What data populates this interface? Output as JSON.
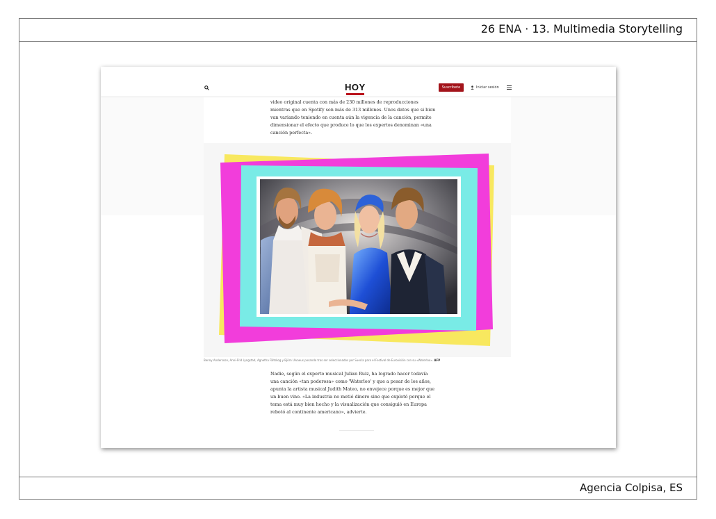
{
  "slide": {
    "title": "26 ENA · 13. Multimedia Storytelling",
    "credit": "Agencia Colpisa, ES"
  },
  "site": {
    "logo": "HOY",
    "subscribe_label": "Suscríbete",
    "login_label": "Iniciar sesión",
    "icons": [
      "search-icon",
      "user-icon",
      "menu-icon"
    ]
  },
  "article": {
    "top_lines": [
      "video original cuenta con más de 230 millones de reproducciones",
      "mientras que en Spotify son más de 313 millones. Unos datos que si bien",
      "van variando teniendo en cuenta aún la vigencia de la canción, permite",
      "dimensionar el efecto que produce lo que los expertos denominan «una",
      "canción perfecta»."
    ],
    "caption": "Benny Andersson, Anni-Frid Lyngstad, Agnetha Fältskog y Björn Ulvaeus posando tras ser seleccionados por Suecia para el Festival de Eurovisión con su «Waterloo».",
    "caption_source": "AFP",
    "bottom_lines": [
      "Nadie, según el experto musical Julian Ruiz, ha logrado hacer todavía",
      "una canción «tan poderosa» como 'Waterloo' y que a pesar de los años,",
      "apunta la artista musical Judith Mateo, no envejece porque es mejor que",
      "un buen vino. «La industria no metió dinero sino que explotó porque el",
      "tema está muy bien hecho y la visualización que consiguió en Europa",
      "rebotó al continente americano», advierte."
    ]
  },
  "colors": {
    "brand_red": "#a3141b",
    "frame_yellow": "#f8e85f",
    "frame_magenta": "#f23ddb",
    "frame_cyan": "#79ebe6"
  }
}
